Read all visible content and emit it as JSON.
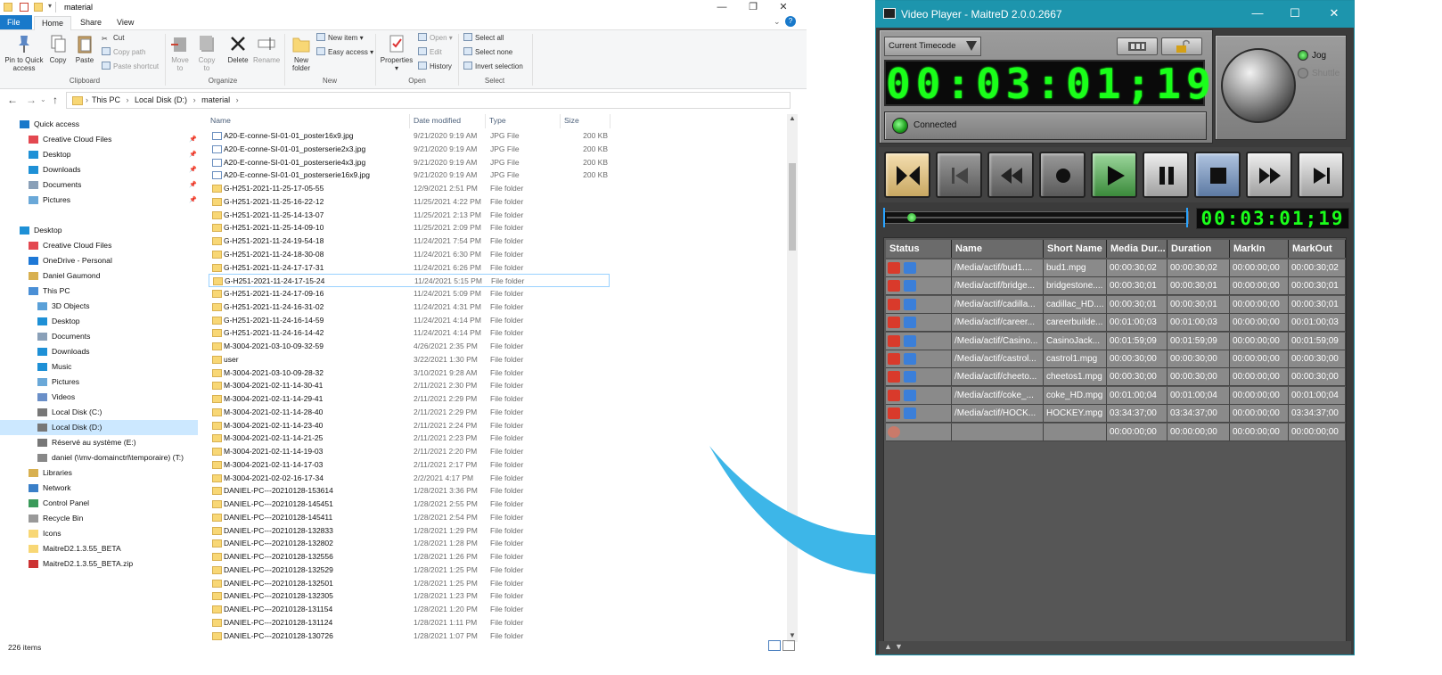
{
  "explorer": {
    "title": "material",
    "tabs": [
      "File",
      "Home",
      "Share",
      "View"
    ],
    "ribbon": {
      "clipboard": {
        "group": "Clipboard",
        "pin": "Pin to Quick access",
        "copy": "Copy",
        "paste": "Paste",
        "cut": "Cut",
        "copy_path": "Copy path",
        "paste_shortcut": "Paste shortcut"
      },
      "organize": {
        "group": "Organize",
        "move_to": "Move to",
        "copy_to": "Copy to",
        "delete": "Delete",
        "rename": "Rename"
      },
      "new": {
        "group": "New",
        "new_folder": "New folder",
        "new_item": "New item",
        "easy_access": "Easy access"
      },
      "open": {
        "group": "Open",
        "properties": "Properties",
        "open": "Open",
        "edit": "Edit",
        "history": "History"
      },
      "select": {
        "group": "Select",
        "select_all": "Select all",
        "select_none": "Select none",
        "invert": "Invert selection"
      }
    },
    "breadcrumb": [
      "This PC",
      "Local Disk (D:)",
      "material"
    ],
    "nav": [
      {
        "label": "Quick access",
        "pin": false,
        "indent": 0
      },
      {
        "label": "Creative Cloud Files",
        "pin": true,
        "indent": 1
      },
      {
        "label": "Desktop",
        "pin": true,
        "indent": 1
      },
      {
        "label": "Downloads",
        "pin": true,
        "indent": 1
      },
      {
        "label": "Documents",
        "pin": true,
        "indent": 1
      },
      {
        "label": "Pictures",
        "pin": true,
        "indent": 1
      },
      {
        "label": "",
        "pin": false,
        "indent": 0
      },
      {
        "label": "Desktop",
        "pin": false,
        "indent": 0
      },
      {
        "label": "Creative Cloud Files",
        "pin": false,
        "indent": 1
      },
      {
        "label": "OneDrive - Personal",
        "pin": false,
        "indent": 1
      },
      {
        "label": "Daniel Gaumond",
        "pin": false,
        "indent": 1
      },
      {
        "label": "This PC",
        "pin": false,
        "indent": 1
      },
      {
        "label": "3D Objects",
        "pin": false,
        "indent": 2
      },
      {
        "label": "Desktop",
        "pin": false,
        "indent": 2
      },
      {
        "label": "Documents",
        "pin": false,
        "indent": 2
      },
      {
        "label": "Downloads",
        "pin": false,
        "indent": 2
      },
      {
        "label": "Music",
        "pin": false,
        "indent": 2
      },
      {
        "label": "Pictures",
        "pin": false,
        "indent": 2
      },
      {
        "label": "Videos",
        "pin": false,
        "indent": 2
      },
      {
        "label": "Local Disk (C:)",
        "pin": false,
        "indent": 2
      },
      {
        "label": "Local Disk (D:)",
        "pin": false,
        "indent": 2,
        "selected": true
      },
      {
        "label": "Réservé au système (E:)",
        "pin": false,
        "indent": 2
      },
      {
        "label": "daniel (\\\\mv-domainctrl\\temporaire) (T:)",
        "pin": false,
        "indent": 2
      },
      {
        "label": "Libraries",
        "pin": false,
        "indent": 1
      },
      {
        "label": "Network",
        "pin": false,
        "indent": 1
      },
      {
        "label": "Control Panel",
        "pin": false,
        "indent": 1
      },
      {
        "label": "Recycle Bin",
        "pin": false,
        "indent": 1
      },
      {
        "label": "Icons",
        "pin": false,
        "indent": 1
      },
      {
        "label": "MaitreD2.1.3.55_BETA",
        "pin": false,
        "indent": 1
      },
      {
        "label": "MaitreD2.1.3.55_BETA.zip",
        "pin": false,
        "indent": 1
      }
    ],
    "columns": [
      "Name",
      "Date modified",
      "Type",
      "Size"
    ],
    "files": [
      [
        "A20-E-conne-SI-01-01_poster16x9.jpg",
        "9/21/2020 9:19 AM",
        "JPG File",
        "200 KB"
      ],
      [
        "A20-E-conne-SI-01-01_posterserie2x3.jpg",
        "9/21/2020 9:19 AM",
        "JPG File",
        "200 KB"
      ],
      [
        "A20-E-conne-SI-01-01_posterserie4x3.jpg",
        "9/21/2020 9:19 AM",
        "JPG File",
        "200 KB"
      ],
      [
        "A20-E-conne-SI-01-01_posterserie16x9.jpg",
        "9/21/2020 9:19 AM",
        "JPG File",
        "200 KB"
      ],
      [
        "G-H251-2021-11-25-17-05-55",
        "12/9/2021 2:51 PM",
        "File folder",
        ""
      ],
      [
        "G-H251-2021-11-25-16-22-12",
        "11/25/2021 4:22 PM",
        "File folder",
        ""
      ],
      [
        "G-H251-2021-11-25-14-13-07",
        "11/25/2021 2:13 PM",
        "File folder",
        ""
      ],
      [
        "G-H251-2021-11-25-14-09-10",
        "11/25/2021 2:09 PM",
        "File folder",
        ""
      ],
      [
        "G-H251-2021-11-24-19-54-18",
        "11/24/2021 7:54 PM",
        "File folder",
        ""
      ],
      [
        "G-H251-2021-11-24-18-30-08",
        "11/24/2021 6:30 PM",
        "File folder",
        ""
      ],
      [
        "G-H251-2021-11-24-17-17-31",
        "11/24/2021 6:26 PM",
        "File folder",
        ""
      ],
      [
        "G-H251-2021-11-24-17-15-24",
        "11/24/2021 5:15 PM",
        "File folder",
        ""
      ],
      [
        "G-H251-2021-11-24-17-09-16",
        "11/24/2021 5:09 PM",
        "File folder",
        ""
      ],
      [
        "G-H251-2021-11-24-16-31-02",
        "11/24/2021 4:31 PM",
        "File folder",
        ""
      ],
      [
        "G-H251-2021-11-24-16-14-59",
        "11/24/2021 4:14 PM",
        "File folder",
        ""
      ],
      [
        "G-H251-2021-11-24-16-14-42",
        "11/24/2021 4:14 PM",
        "File folder",
        ""
      ],
      [
        "M-3004-2021-03-10-09-32-59",
        "4/26/2021 2:35 PM",
        "File folder",
        ""
      ],
      [
        "user",
        "3/22/2021 1:30 PM",
        "File folder",
        ""
      ],
      [
        "M-3004-2021-03-10-09-28-32",
        "3/10/2021 9:28 AM",
        "File folder",
        ""
      ],
      [
        "M-3004-2021-02-11-14-30-41",
        "2/11/2021 2:30 PM",
        "File folder",
        ""
      ],
      [
        "M-3004-2021-02-11-14-29-41",
        "2/11/2021 2:29 PM",
        "File folder",
        ""
      ],
      [
        "M-3004-2021-02-11-14-28-40",
        "2/11/2021 2:29 PM",
        "File folder",
        ""
      ],
      [
        "M-3004-2021-02-11-14-23-40",
        "2/11/2021 2:24 PM",
        "File folder",
        ""
      ],
      [
        "M-3004-2021-02-11-14-21-25",
        "2/11/2021 2:23 PM",
        "File folder",
        ""
      ],
      [
        "M-3004-2021-02-11-14-19-03",
        "2/11/2021 2:20 PM",
        "File folder",
        ""
      ],
      [
        "M-3004-2021-02-11-14-17-03",
        "2/11/2021 2:17 PM",
        "File folder",
        ""
      ],
      [
        "M-3004-2021-02-02-16-17-34",
        "2/2/2021 4:17 PM",
        "File folder",
        ""
      ],
      [
        "DANIEL-PC---20210128-153614",
        "1/28/2021 3:36 PM",
        "File folder",
        ""
      ],
      [
        "DANIEL-PC---20210128-145451",
        "1/28/2021 2:55 PM",
        "File folder",
        ""
      ],
      [
        "DANIEL-PC---20210128-145411",
        "1/28/2021 2:54 PM",
        "File folder",
        ""
      ],
      [
        "DANIEL-PC---20210128-132833",
        "1/28/2021 1:29 PM",
        "File folder",
        ""
      ],
      [
        "DANIEL-PC---20210128-132802",
        "1/28/2021 1:28 PM",
        "File folder",
        ""
      ],
      [
        "DANIEL-PC---20210128-132556",
        "1/28/2021 1:26 PM",
        "File folder",
        ""
      ],
      [
        "DANIEL-PC---20210128-132529",
        "1/28/2021 1:25 PM",
        "File folder",
        ""
      ],
      [
        "DANIEL-PC---20210128-132501",
        "1/28/2021 1:25 PM",
        "File folder",
        ""
      ],
      [
        "DANIEL-PC---20210128-132305",
        "1/28/2021 1:23 PM",
        "File folder",
        ""
      ],
      [
        "DANIEL-PC---20210128-131154",
        "1/28/2021 1:20 PM",
        "File folder",
        ""
      ],
      [
        "DANIEL-PC---20210128-131124",
        "1/28/2021 1:11 PM",
        "File folder",
        ""
      ],
      [
        "DANIEL-PC---20210128-130726",
        "1/28/2021 1:07 PM",
        "File folder",
        ""
      ]
    ],
    "selected_index": 11,
    "status": "226 items"
  },
  "player": {
    "title": "Video Player - MaitreD 2.0.0.2667",
    "timecode_mode": "Current Timecode",
    "timecode": "00:03:01;19",
    "connection": "Connected",
    "jog_label": "Jog",
    "shuttle_label": "Shuttle",
    "columns": [
      "Status",
      "Name",
      "Short Name",
      "Media Dur...",
      "Duration",
      "MarkIn",
      "MarkOut"
    ],
    "rows": [
      [
        "/Media/actif/bud1....",
        "bud1.mpg",
        "00:00:30;02",
        "00:00:30;02",
        "00:00:00;00",
        "00:00:30;02"
      ],
      [
        "/Media/actif/bridge...",
        "bridgestone....",
        "00:00:30;01",
        "00:00:30;01",
        "00:00:00;00",
        "00:00:30;01"
      ],
      [
        "/Media/actif/cadilla...",
        "cadillac_HD....",
        "00:00:30;01",
        "00:00:30;01",
        "00:00:00;00",
        "00:00:30;01"
      ],
      [
        "/Media/actif/career...",
        "careerbuilde...",
        "00:01:00;03",
        "00:01:00;03",
        "00:00:00;00",
        "00:01:00;03"
      ],
      [
        "/Media/actif/Casino...",
        "CasinoJack...",
        "00:01:59;09",
        "00:01:59;09",
        "00:00:00;00",
        "00:01:59;09"
      ],
      [
        "/Media/actif/castrol...",
        "castrol1.mpg",
        "00:00:30;00",
        "00:00:30;00",
        "00:00:00;00",
        "00:00:30;00"
      ],
      [
        "/Media/actif/cheeto...",
        "cheetos1.mpg",
        "00:00:30;00",
        "00:00:30;00",
        "00:00:00;00",
        "00:00:30;00"
      ],
      [
        "/Media/actif/coke_...",
        "coke_HD.mpg",
        "00:01:00;04",
        "00:01:00;04",
        "00:00:00;00",
        "00:01:00;04"
      ],
      [
        "/Media/actif/HOCK...",
        "HOCKEY.mpg",
        "03:34:37;00",
        "03:34:37;00",
        "00:00:00;00",
        "03:34:37;00"
      ],
      [
        "",
        "",
        "00:00:00;00",
        "00:00:00;00",
        "00:00:00;00",
        "00:00:00;00"
      ]
    ],
    "scrub_position": 0.07,
    "colors": {
      "title_bar": "#1d95ad",
      "timecode_green": "#1aff1a",
      "status_red": "#d93a2b",
      "status_blue": "#3b7fd9"
    }
  }
}
